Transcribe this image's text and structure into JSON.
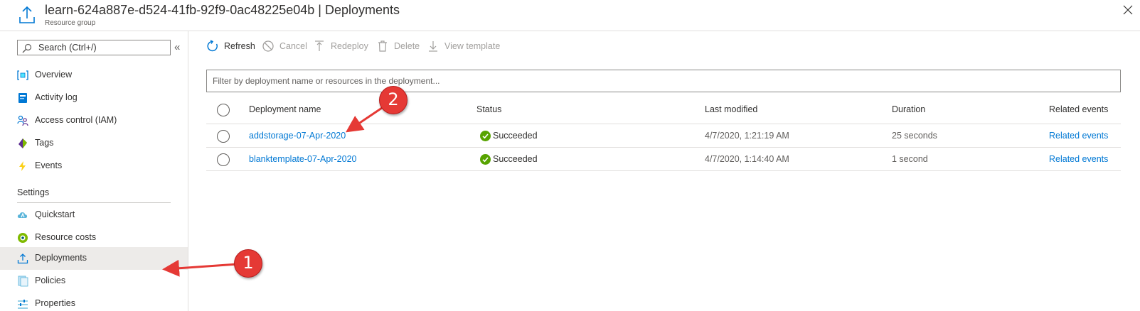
{
  "header": {
    "title": "learn-624a887e-d524-41fb-92f9-0ac48225e04b | Deployments",
    "subtitle": "Resource group",
    "icon": "deployment-upload-icon",
    "close_icon": "close-icon"
  },
  "sidebar": {
    "search_placeholder": "Search (Ctrl+/)",
    "collapse_label": "«",
    "items": [
      {
        "label": "Overview",
        "icon": "resource-group-icon"
      },
      {
        "label": "Activity log",
        "icon": "activity-log-icon"
      },
      {
        "label": "Access control (IAM)",
        "icon": "people-icon"
      },
      {
        "label": "Tags",
        "icon": "tag-icon"
      },
      {
        "label": "Events",
        "icon": "lightning-icon"
      }
    ],
    "section_title": "Settings",
    "settings_items": [
      {
        "label": "Quickstart",
        "icon": "cloud-quickstart-icon"
      },
      {
        "label": "Resource costs",
        "icon": "cost-circle-icon"
      },
      {
        "label": "Deployments",
        "icon": "deployment-upload-icon",
        "selected": true
      },
      {
        "label": "Policies",
        "icon": "policy-document-icon"
      },
      {
        "label": "Properties",
        "icon": "properties-sliders-icon"
      }
    ]
  },
  "toolbar": {
    "refresh": "Refresh",
    "cancel": "Cancel",
    "redeploy": "Redeploy",
    "delete": "Delete",
    "view_template": "View template"
  },
  "filter": {
    "placeholder": "Filter by deployment name or resources in the deployment..."
  },
  "table": {
    "columns": [
      "Deployment name",
      "Status",
      "Last modified",
      "Duration",
      "Related events"
    ],
    "rows": [
      {
        "name": "addstorage-07-Apr-2020",
        "status": "Succeeded",
        "modified": "4/7/2020, 1:21:19 AM",
        "duration": "25 seconds",
        "events": "Related events"
      },
      {
        "name": "blanktemplate-07-Apr-2020",
        "status": "Succeeded",
        "modified": "4/7/2020, 1:14:40 AM",
        "duration": "1 second",
        "events": "Related events"
      }
    ]
  },
  "annotations": {
    "badge_1": "1",
    "badge_2": "2"
  },
  "colors": {
    "accent": "#0078d4",
    "success": "#57a300",
    "annotation": "#e53935"
  }
}
